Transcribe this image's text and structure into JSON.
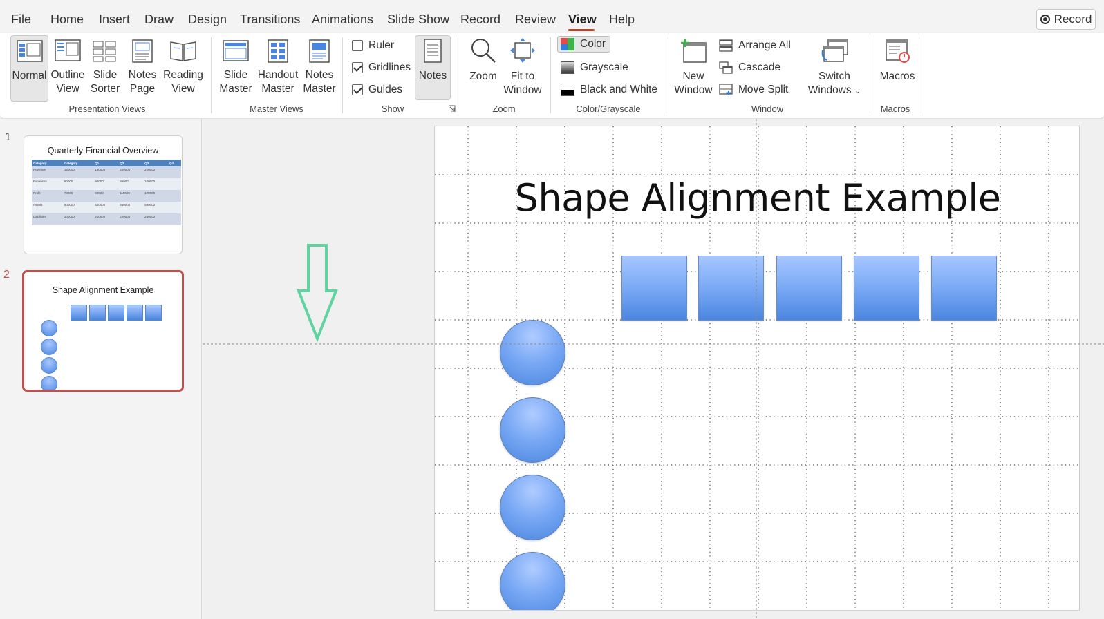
{
  "menu": {
    "items": [
      "File",
      "Home",
      "Insert",
      "Draw",
      "Design",
      "Transitions",
      "Animations",
      "Slide Show",
      "Record",
      "Review",
      "View",
      "Help"
    ],
    "active": "View",
    "record_button": "Record"
  },
  "ribbon": {
    "presentation_views": {
      "label": "Presentation Views",
      "buttons": [
        {
          "line1": "Normal",
          "line2": ""
        },
        {
          "line1": "Outline",
          "line2": "View"
        },
        {
          "line1": "Slide",
          "line2": "Sorter"
        },
        {
          "line1": "Notes",
          "line2": "Page"
        },
        {
          "line1": "Reading",
          "line2": "View"
        }
      ]
    },
    "master_views": {
      "label": "Master Views",
      "buttons": [
        {
          "line1": "Slide",
          "line2": "Master"
        },
        {
          "line1": "Handout",
          "line2": "Master"
        },
        {
          "line1": "Notes",
          "line2": "Master"
        }
      ]
    },
    "show": {
      "label": "Show",
      "checkboxes": [
        {
          "label": "Ruler",
          "checked": false
        },
        {
          "label": "Gridlines",
          "checked": true
        },
        {
          "label": "Guides",
          "checked": true
        }
      ],
      "notes_button": "Notes"
    },
    "zoom": {
      "label": "Zoom",
      "zoom_button": "Zoom",
      "fit_line1": "Fit to",
      "fit_line2": "Window"
    },
    "color_grayscale": {
      "label": "Color/Grayscale",
      "options": [
        "Color",
        "Grayscale",
        "Black and White"
      ],
      "selected": "Color"
    },
    "window": {
      "label": "Window",
      "new_line1": "New",
      "new_line2": "Window",
      "small_buttons": [
        "Arrange All",
        "Cascade",
        "Move Split"
      ],
      "switch_line1": "Switch",
      "switch_line2": "Windows"
    },
    "macros": {
      "label": "Macros",
      "button": "Macros"
    }
  },
  "thumbnails": {
    "slides": [
      {
        "number": "1",
        "title": "Quarterly Financial Overview",
        "table": {
          "headers": [
            "Category",
            "Category",
            "Q1",
            "Q2",
            "Q3",
            "Q4"
          ],
          "rows": [
            [
              "Revenue",
              "150000",
              "180000",
              "200000",
              "220000",
              ""
            ],
            [
              "Expenses",
              "80000",
              "90000",
              "85000",
              "100000",
              ""
            ],
            [
              "Profit",
              "70000",
              "90000",
              "115000",
              "120000",
              ""
            ],
            [
              "Assets",
              "500000",
              "520000",
              "550000",
              "580000",
              ""
            ],
            [
              "Liabilities",
              "200000",
              "210000",
              "220000",
              "230000",
              ""
            ]
          ]
        }
      },
      {
        "number": "2",
        "title": "Shape Alignment Example",
        "selected": true
      }
    ]
  },
  "slide": {
    "title": "Shape Alignment Example",
    "square_count": 5,
    "circle_count": 4,
    "shape_color": "#4a86e0"
  },
  "annotation": {
    "arrow_color": "#5fd3a0",
    "direction": "down"
  }
}
